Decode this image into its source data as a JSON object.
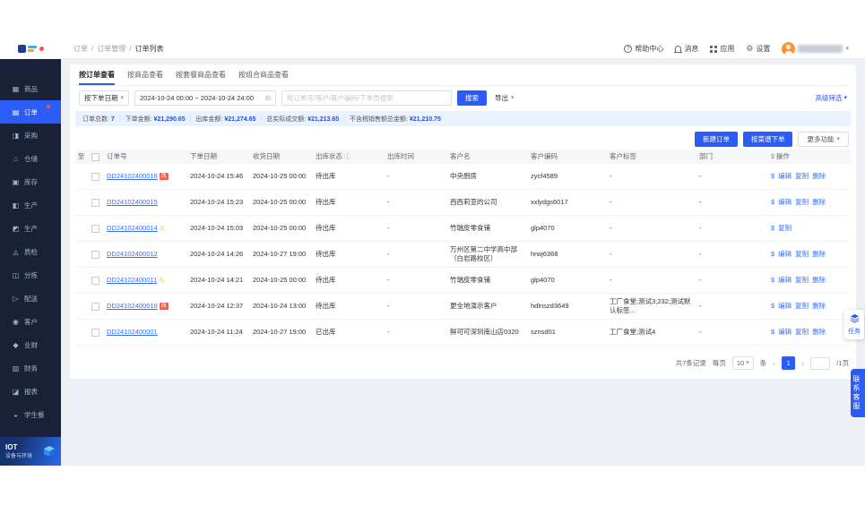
{
  "colors": {
    "primary": "#2b5cf7",
    "sidebar_bg": "#182138",
    "link": "#3370ff",
    "summary_bg": "#e9f2fe",
    "badge": "#ff5b45",
    "avatar": "#ff9632"
  },
  "icons": {
    "help": "?",
    "gear": "⚙",
    "caret_down": "▾",
    "calendar": "⊞",
    "info": "ⓘ",
    "warning": "⚠",
    "money": "$",
    "chevron_left": "‹",
    "chevron_right": "›"
  },
  "topbar": {
    "breadcrumb": [
      "订单",
      "订单管理",
      "订单列表"
    ],
    "breadcrumb_sep": "/",
    "help": "帮助中心",
    "messages": "消息",
    "apps": "应用",
    "settings": "设置"
  },
  "sidebar": {
    "items": [
      {
        "name": "goods",
        "icon": "▦",
        "label": "商品",
        "active": false,
        "dot": false
      },
      {
        "name": "orders",
        "icon": "▤",
        "label": "订单",
        "active": true,
        "dot": true
      },
      {
        "name": "procurement",
        "icon": "◨",
        "label": "采购",
        "active": false,
        "dot": false
      },
      {
        "name": "warehouse",
        "icon": "⌂",
        "label": "仓储",
        "active": false,
        "dot": false
      },
      {
        "name": "inventory",
        "icon": "▣",
        "label": "库存",
        "active": false,
        "dot": false
      },
      {
        "name": "production",
        "icon": "◧",
        "label": "生产",
        "active": false,
        "dot": false
      },
      {
        "name": "production-2",
        "icon": "◩",
        "label": "生产",
        "active": false,
        "dot": false
      },
      {
        "name": "quality",
        "icon": "◬",
        "label": "质检",
        "active": false,
        "dot": false
      },
      {
        "name": "sorting",
        "icon": "◫",
        "label": "分拣",
        "active": false,
        "dot": false
      },
      {
        "name": "delivery",
        "icon": "▷",
        "label": "配送",
        "active": false,
        "dot": false
      },
      {
        "name": "customers",
        "icon": "◉",
        "label": "客户",
        "active": false,
        "dot": false
      },
      {
        "name": "business-finance",
        "icon": "◆",
        "label": "业财",
        "active": false,
        "dot": false
      },
      {
        "name": "finance",
        "icon": "▥",
        "label": "财务",
        "active": false,
        "dot": false
      },
      {
        "name": "reports",
        "icon": "◪",
        "label": "报表",
        "active": false,
        "dot": false
      },
      {
        "name": "student-meals",
        "icon": "◒",
        "label": "学生餐",
        "active": false,
        "dot": false
      }
    ],
    "iot_title": "IOT",
    "iot_subtitle": "设备与环境"
  },
  "tabs": [
    {
      "label": "按订单查看",
      "active": true
    },
    {
      "label": "按商品查看",
      "active": false
    },
    {
      "label": "按套餐商品查看",
      "active": false
    },
    {
      "label": "按组合商品查看",
      "active": false
    }
  ],
  "filter": {
    "date_type": "按下单日期",
    "date_range": "2024-10-24 00:00 ~ 2024-10-24 24:00",
    "search_placeholder": "按订单号/客户/客户编码/下单员搜索",
    "search_button": "搜索",
    "export_button": "导出",
    "advanced_filter": "高级筛选"
  },
  "summary": {
    "sep": "|",
    "items": [
      {
        "label": "订单总数:",
        "value": "7"
      },
      {
        "label": "下单金额:",
        "value": "¥21,290.65"
      },
      {
        "label": "出库金额:",
        "value": "¥21,274.65"
      },
      {
        "label": "总实际成交额:",
        "value": "¥21,213.65"
      },
      {
        "label": "不含税销售额总金额:",
        "value": "¥21,210.75"
      }
    ]
  },
  "actions": {
    "new_order": "新建订单",
    "menu_order": "按菜谱下单",
    "more": "更多功能"
  },
  "table": {
    "expand_header": "至",
    "badge_text": "改",
    "columns": [
      "订单号",
      "下单日期",
      "收货日期",
      "出库状态",
      "出库时间",
      "客户名",
      "客户编码",
      "客户标签",
      "部门",
      "操作"
    ],
    "rows": [
      {
        "order_no": "DD24102400016",
        "mark": "modified",
        "order_date": "2024-10-24 15:46",
        "receive_date": "2024-10-25 00:00",
        "status": "待出库",
        "out_time": "-",
        "customer": "中央厨房",
        "customer_code": "zycf4589",
        "tags": "-",
        "dept": "-",
        "actions": [
          "编辑",
          "复制",
          "删除"
        ]
      },
      {
        "order_no": "DD24102400015",
        "mark": null,
        "order_date": "2024-10-24 15:23",
        "receive_date": "2024-10-25 00:00",
        "status": "待出库",
        "out_time": "-",
        "customer": "西西莉亚的公司",
        "customer_code": "xxlydgs6017",
        "tags": "-",
        "dept": "-",
        "actions": [
          "编辑",
          "复制",
          "删除"
        ]
      },
      {
        "order_no": "DD24102400014",
        "mark": "warning",
        "order_date": "2024-10-24 15:03",
        "receive_date": "2024-10-25 00:00",
        "status": "待出库",
        "out_time": "-",
        "customer": "竹瑞皮零食铺",
        "customer_code": "glp4070",
        "tags": "-",
        "dept": "-",
        "actions": [
          "复制"
        ]
      },
      {
        "order_no": "DD24102400012",
        "mark": null,
        "order_date": "2024-10-24 14:26",
        "receive_date": "2024-10-27 19:00",
        "status": "待出库",
        "out_time": "-",
        "customer": "万州区第二中学高中部（白岩路校区）",
        "customer_code": "hrwj6368",
        "tags": "-",
        "dept": "-",
        "actions": [
          "编辑",
          "复制",
          "删除"
        ]
      },
      {
        "order_no": "DD24102400011",
        "mark": "warning",
        "order_date": "2024-10-24 14:21",
        "receive_date": "2024-10-25 00:00",
        "status": "待出库",
        "out_time": "-",
        "customer": "竹瑞皮零食铺",
        "customer_code": "glp4070",
        "tags": "-",
        "dept": "-",
        "actions": [
          "编辑",
          "复制",
          "删除"
        ]
      },
      {
        "order_no": "DD24102400010",
        "mark": "modified",
        "order_date": "2024-10-24 12:37",
        "receive_date": "2024-10-24 13:00",
        "status": "待出库",
        "out_time": "-",
        "customer": "更全地演示客户",
        "customer_code": "hdlnszd3649",
        "tags": "工厂食堂;测试3;232;测试默认标签...",
        "dept": "-",
        "actions": [
          "编辑",
          "复制",
          "删除"
        ]
      },
      {
        "order_no": "DD24102400001",
        "mark": null,
        "order_date": "2024-10-24 11:24",
        "receive_date": "2024-10-27 19:00",
        "status": "已出库",
        "out_time": "-",
        "customer": "鲜可可深圳南山店0320",
        "customer_code": "sznsd01",
        "tags": "工厂食堂;测试4",
        "dept": "-",
        "actions": [
          "编辑",
          "复制",
          "删除"
        ]
      }
    ]
  },
  "pagination": {
    "total": "共7条记录",
    "per_page_prefix": "每页",
    "per_page": "10",
    "per_page_suffix": "条",
    "page": "1",
    "page_suffix": "/1页"
  },
  "floating": {
    "task": "任务",
    "service": "联系客服"
  }
}
